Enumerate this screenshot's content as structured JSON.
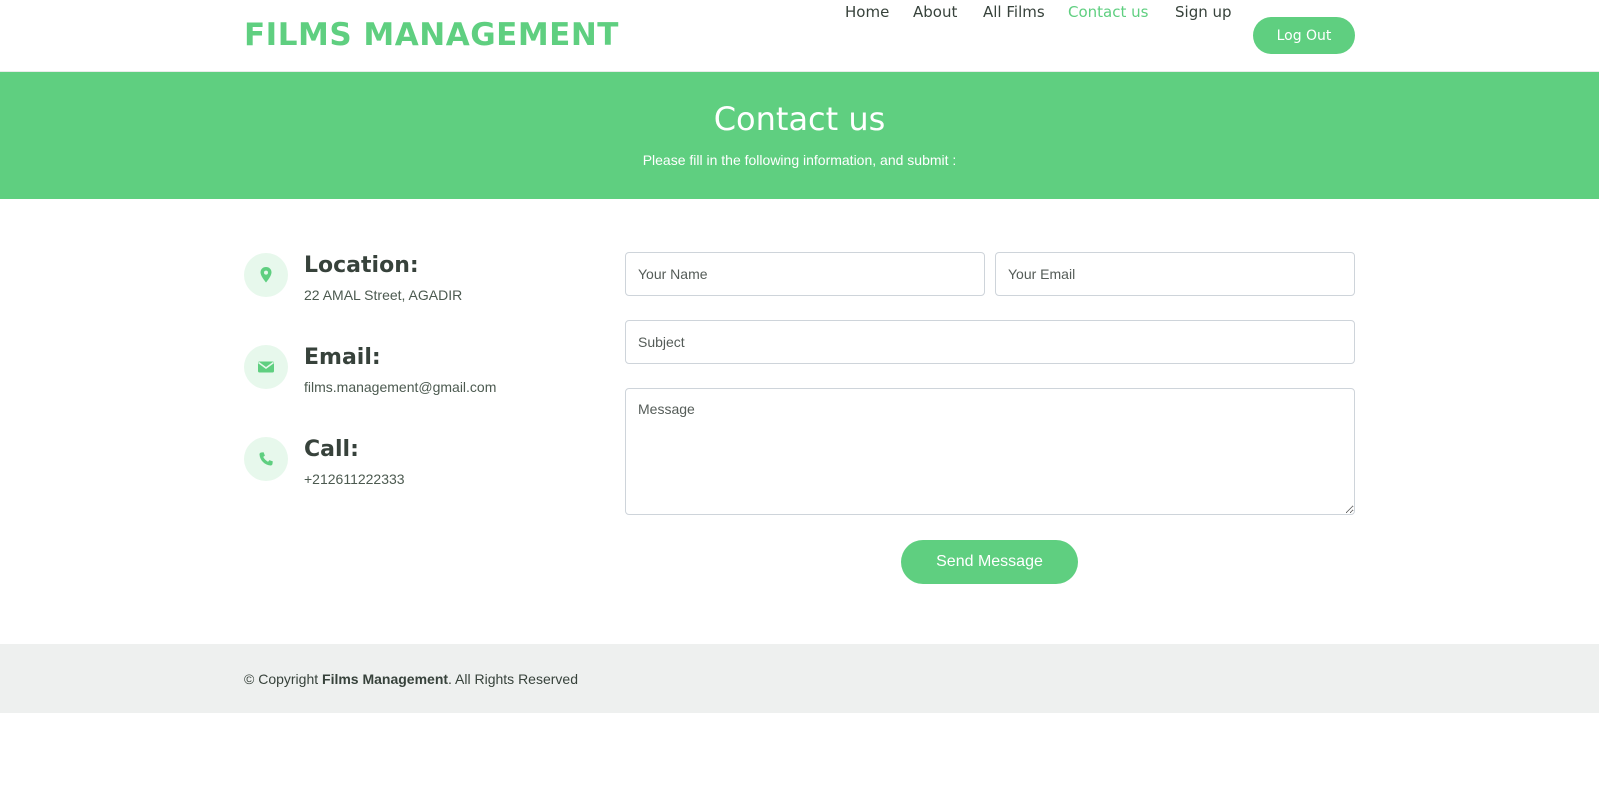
{
  "header": {
    "logo": "FILMS MANAGEMENT",
    "nav": [
      {
        "label": "Home",
        "active": false
      },
      {
        "label": "About",
        "active": false
      },
      {
        "label": "All Films",
        "active": false
      },
      {
        "label": "Contact us",
        "active": true
      },
      {
        "label": "Sign up",
        "active": false
      }
    ],
    "logout_label": "Log Out"
  },
  "banner": {
    "title": "Contact us",
    "subtitle": "Please fill in the following information, and submit :"
  },
  "contact_info": [
    {
      "title": "Location:",
      "text": "22 AMAL Street, AGADIR",
      "icon": "map-pin-icon"
    },
    {
      "title": "Email:",
      "text": "films.management@gmail.com",
      "icon": "envelope-icon"
    },
    {
      "title": "Call:",
      "text": "+212611222333",
      "icon": "phone-icon"
    }
  ],
  "form": {
    "name_placeholder": "Your Name",
    "email_placeholder": "Your Email",
    "subject_placeholder": "Subject",
    "message_placeholder": "Message",
    "send_label": "Send Message"
  },
  "footer": {
    "prefix": "© Copyright",
    "brand": "Films Management",
    "suffix": ". All Rights Reserved"
  },
  "colors": {
    "accent": "#5fcf80",
    "text_dark": "#37423b",
    "icon_bg": "#e7f8ec",
    "footer_bg": "#eef0ef"
  }
}
